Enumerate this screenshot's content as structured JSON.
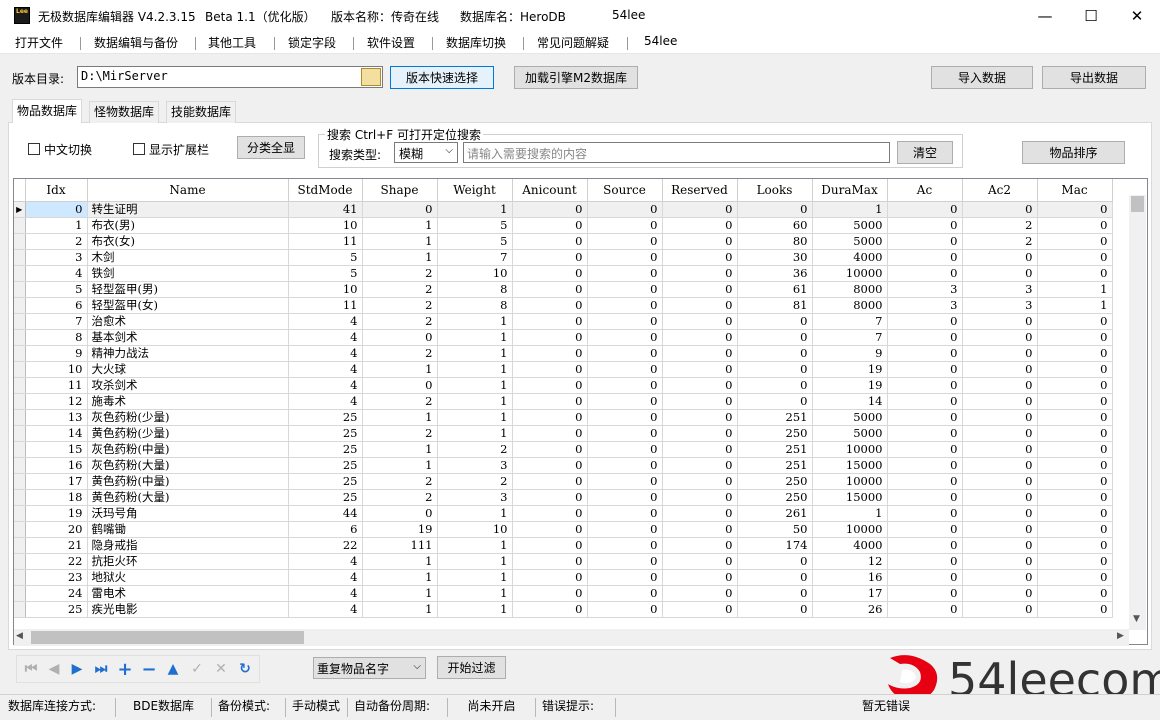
{
  "title": {
    "app_name": "无极数据库编辑器 V4.2.3.15",
    "beta": "Beta 1.1（优化版）",
    "version_name": "版本名称：传奇在线",
    "db_name": "数据库名：HeroDB",
    "site": "54lee",
    "icon_text": "Lee"
  },
  "window_controls": {
    "minimize": "—",
    "maximize": "☐",
    "close": "✕"
  },
  "menu": [
    "打开文件",
    "数据编辑与备份",
    "其他工具",
    "锁定字段",
    "软件设置",
    "数据库切换",
    "常见问题解疑",
    "54lee"
  ],
  "toolbar": {
    "dir_label": "版本目录:",
    "dir_value": "D:\\MirServer",
    "quick_select": "版本快速选择",
    "load_engine": "加载引擎M2数据库",
    "import": "导入数据",
    "export": "导出数据"
  },
  "tabs": [
    "物品数据库",
    "怪物数据库",
    "技能数据库"
  ],
  "options": {
    "chinese_switch": "中文切换",
    "show_ext": "显示扩展栏",
    "show_all_categories": "分类全显",
    "search_title": "搜索  Ctrl+F 可打开定位搜索",
    "search_type_label": "搜索类型:",
    "search_type_value": "模糊",
    "search_placeholder": "请输入需要搜索的内容",
    "clear": "清空",
    "sort_items": "物品排序"
  },
  "grid": {
    "columns": [
      "Idx",
      "Name",
      "StdMode",
      "Shape",
      "Weight",
      "Anicount",
      "Source",
      "Reserved",
      "Looks",
      "DuraMax",
      "Ac",
      "Ac2",
      "Mac"
    ],
    "rows": [
      [
        "0",
        "转生证明",
        "41",
        "0",
        "1",
        "0",
        "0",
        "0",
        "0",
        "1",
        "0",
        "0",
        "0"
      ],
      [
        "1",
        "布衣(男)",
        "10",
        "1",
        "5",
        "0",
        "0",
        "0",
        "60",
        "5000",
        "0",
        "2",
        "0"
      ],
      [
        "2",
        "布衣(女)",
        "11",
        "1",
        "5",
        "0",
        "0",
        "0",
        "80",
        "5000",
        "0",
        "2",
        "0"
      ],
      [
        "3",
        "木剑",
        "5",
        "1",
        "7",
        "0",
        "0",
        "0",
        "30",
        "4000",
        "0",
        "0",
        "0"
      ],
      [
        "4",
        "铁剑",
        "5",
        "2",
        "10",
        "0",
        "0",
        "0",
        "36",
        "10000",
        "0",
        "0",
        "0"
      ],
      [
        "5",
        "轻型盔甲(男)",
        "10",
        "2",
        "8",
        "0",
        "0",
        "0",
        "61",
        "8000",
        "3",
        "3",
        "1"
      ],
      [
        "6",
        "轻型盔甲(女)",
        "11",
        "2",
        "8",
        "0",
        "0",
        "0",
        "81",
        "8000",
        "3",
        "3",
        "1"
      ],
      [
        "7",
        "治愈术",
        "4",
        "2",
        "1",
        "0",
        "0",
        "0",
        "0",
        "7",
        "0",
        "0",
        "0"
      ],
      [
        "8",
        "基本剑术",
        "4",
        "0",
        "1",
        "0",
        "0",
        "0",
        "0",
        "7",
        "0",
        "0",
        "0"
      ],
      [
        "9",
        "精神力战法",
        "4",
        "2",
        "1",
        "0",
        "0",
        "0",
        "0",
        "9",
        "0",
        "0",
        "0"
      ],
      [
        "10",
        "大火球",
        "4",
        "1",
        "1",
        "0",
        "0",
        "0",
        "0",
        "19",
        "0",
        "0",
        "0"
      ],
      [
        "11",
        "攻杀剑术",
        "4",
        "0",
        "1",
        "0",
        "0",
        "0",
        "0",
        "19",
        "0",
        "0",
        "0"
      ],
      [
        "12",
        "施毒术",
        "4",
        "2",
        "1",
        "0",
        "0",
        "0",
        "0",
        "14",
        "0",
        "0",
        "0"
      ],
      [
        "13",
        "灰色药粉(少量)",
        "25",
        "1",
        "1",
        "0",
        "0",
        "0",
        "251",
        "5000",
        "0",
        "0",
        "0"
      ],
      [
        "14",
        "黄色药粉(少量)",
        "25",
        "2",
        "1",
        "0",
        "0",
        "0",
        "250",
        "5000",
        "0",
        "0",
        "0"
      ],
      [
        "15",
        "灰色药粉(中量)",
        "25",
        "1",
        "2",
        "0",
        "0",
        "0",
        "251",
        "10000",
        "0",
        "0",
        "0"
      ],
      [
        "16",
        "灰色药粉(大量)",
        "25",
        "1",
        "3",
        "0",
        "0",
        "0",
        "251",
        "15000",
        "0",
        "0",
        "0"
      ],
      [
        "17",
        "黄色药粉(中量)",
        "25",
        "2",
        "2",
        "0",
        "0",
        "0",
        "250",
        "10000",
        "0",
        "0",
        "0"
      ],
      [
        "18",
        "黄色药粉(大量)",
        "25",
        "2",
        "3",
        "0",
        "0",
        "0",
        "250",
        "15000",
        "0",
        "0",
        "0"
      ],
      [
        "19",
        "沃玛号角",
        "44",
        "0",
        "1",
        "0",
        "0",
        "0",
        "261",
        "1",
        "0",
        "0",
        "0"
      ],
      [
        "20",
        "鹤嘴锄",
        "6",
        "19",
        "10",
        "0",
        "0",
        "0",
        "50",
        "10000",
        "0",
        "0",
        "0"
      ],
      [
        "21",
        "隐身戒指",
        "22",
        "111",
        "1",
        "0",
        "0",
        "0",
        "174",
        "4000",
        "0",
        "0",
        "0"
      ],
      [
        "22",
        "抗拒火环",
        "4",
        "1",
        "1",
        "0",
        "0",
        "0",
        "0",
        "12",
        "0",
        "0",
        "0"
      ],
      [
        "23",
        "地狱火",
        "4",
        "1",
        "1",
        "0",
        "0",
        "0",
        "0",
        "16",
        "0",
        "0",
        "0"
      ],
      [
        "24",
        "雷电术",
        "4",
        "1",
        "1",
        "0",
        "0",
        "0",
        "0",
        "17",
        "0",
        "0",
        "0"
      ],
      [
        "25",
        "疾光电影",
        "4",
        "1",
        "1",
        "0",
        "0",
        "0",
        "0",
        "26",
        "0",
        "0",
        "0"
      ]
    ]
  },
  "nav_icons": [
    "first-icon",
    "prior-icon",
    "next-icon",
    "last-icon",
    "insert-icon",
    "delete-icon",
    "edit-icon",
    "post-icon",
    "cancel-icon",
    "refresh-icon"
  ],
  "filter": {
    "dropdown_value": "重复物品名字",
    "start_filter": "开始过滤"
  },
  "status": {
    "conn_label": "数据库连接方式:",
    "conn_value": "BDE数据库",
    "backup_label": "备份模式:",
    "backup_value": "手动模式",
    "auto_backup_label": "自动备份周期:",
    "auto_backup_value": "尚未开启",
    "error_label": "错误提示:",
    "error_value": "暂无错误"
  },
  "watermark": {
    "text": "54leecom"
  },
  "colors": {
    "selection": "#cde8ff",
    "nav_blue": "#1f6fd1",
    "watermark_red": "#e60012"
  }
}
